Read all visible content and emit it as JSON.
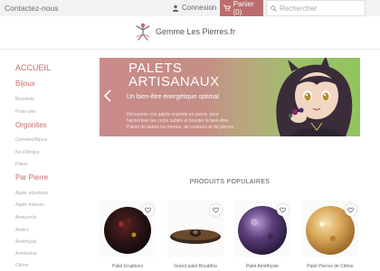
{
  "topbar": {
    "contact_label": "Contactez-nous",
    "login_label": "Connexion",
    "cart_label": "Panier (0)",
    "search_placeholder": "Rechercher"
  },
  "header": {
    "brand_name": "Gemme Les Pierres.fr"
  },
  "sidebar": {
    "accueil": "ACCUEIL",
    "bijoux": {
      "label": "Bijoux",
      "items": [
        "Bracelets",
        "Porte-clés"
      ]
    },
    "orgonites": {
      "label": "Orgonites",
      "items": [
        "Gemmes/Bijoux",
        "Kit d'Afrique",
        "Palets"
      ]
    },
    "par_pierre": {
      "label": "Par Pierre",
      "items": [
        "Agate aquatique",
        "Agate mousse",
        "Amazonite",
        "Ambre",
        "Améthyste",
        "Aventurine",
        "Citrine"
      ]
    }
  },
  "banner": {
    "title": "PALETS ARTISANAUX",
    "subtitle": "Un bien-être énergétique optimal",
    "description": "Découvrez nos palets orgonite en pierre, pour harmoniser les corps subtils et booster le bien-être. Palets de toutes les formes, de couleurs et de pierres."
  },
  "products_section": {
    "title": "PRODUITS POPULAIRES",
    "items": [
      {
        "name": "Palet Eruptions"
      },
      {
        "name": "Grand palet Bouddha"
      },
      {
        "name": "Palet Améthyste"
      },
      {
        "name": "Palet Pierres de Citrine"
      }
    ]
  },
  "colors": {
    "accent": "#bb6d6d",
    "category": "#c96a6a",
    "banner_left": "#c98a8a",
    "banner_right": "#91c45e"
  }
}
